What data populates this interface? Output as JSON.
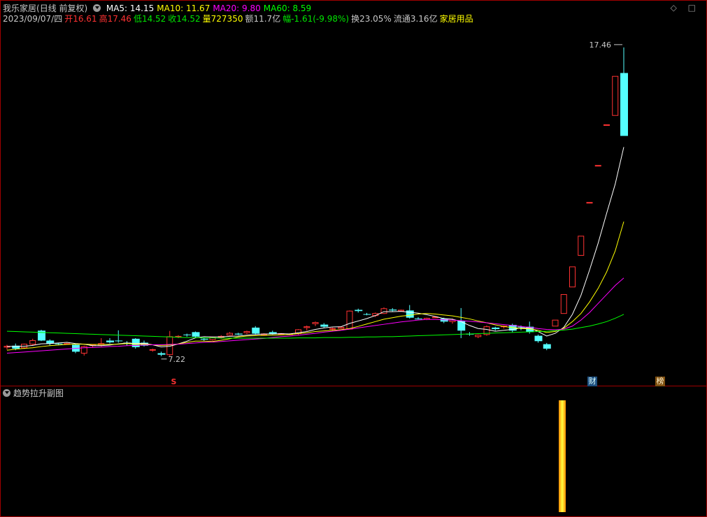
{
  "header": {
    "stock_name": "我乐家居",
    "mode": "(日线 前复权)",
    "ma_labels": [
      {
        "text": "MA5: 14.15",
        "color": "#ffffff"
      },
      {
        "text": "MA10: 11.67",
        "color": "#ffff00"
      },
      {
        "text": "MA20: 9.80",
        "color": "#ff00ff"
      },
      {
        "text": "MA60: 8.59",
        "color": "#00ff00"
      }
    ],
    "win_controls": "◇ □",
    "info": [
      {
        "text": "2023/09/07/四",
        "color": "#c8c8c8"
      },
      {
        "text": "开16.61",
        "color": "#ff3232"
      },
      {
        "text": "高17.46",
        "color": "#ff3232"
      },
      {
        "text": "低14.52",
        "color": "#00e600"
      },
      {
        "text": "收14.52",
        "color": "#00e600"
      },
      {
        "text": "量727350",
        "color": "#ffff00"
      },
      {
        "text": "额11.7亿",
        "color": "#c8c8c8"
      },
      {
        "text": "幅-1.61(-9.98%)",
        "color": "#00e600"
      },
      {
        "text": "换23.05%",
        "color": "#c8c8c8"
      },
      {
        "text": "流通3.16亿",
        "color": "#c8c8c8"
      },
      {
        "text": "家居用品",
        "color": "#ffff00"
      }
    ]
  },
  "chart_data": {
    "type": "candlestick",
    "price_range": [
      6.5,
      18.2
    ],
    "annotations": {
      "high_label": "17.46",
      "low_label": "7.22",
      "flag_s": "S",
      "flag_cai": "财",
      "flag_bang": "榜"
    },
    "candles": [
      [
        7.5,
        7.58,
        7.42,
        7.53
      ],
      [
        7.55,
        7.62,
        7.4,
        7.45
      ],
      [
        7.48,
        7.62,
        7.44,
        7.6
      ],
      [
        7.6,
        7.78,
        7.55,
        7.72
      ],
      [
        8.05,
        8.08,
        7.7,
        7.72
      ],
      [
        7.72,
        7.76,
        7.56,
        7.62
      ],
      [
        7.62,
        7.65,
        7.58,
        7.6
      ],
      [
        7.6,
        7.64,
        7.58,
        7.62
      ],
      [
        7.58,
        7.6,
        7.3,
        7.35
      ],
      [
        7.3,
        7.55,
        7.22,
        7.52
      ],
      [
        7.55,
        7.6,
        7.5,
        7.58
      ],
      [
        7.56,
        7.8,
        7.52,
        7.62
      ],
      [
        7.72,
        7.8,
        7.62,
        7.66
      ],
      [
        7.72,
        8.06,
        7.65,
        7.7
      ],
      [
        7.65,
        7.7,
        7.56,
        7.62
      ],
      [
        7.78,
        7.8,
        7.45,
        7.5
      ],
      [
        7.65,
        7.72,
        7.52,
        7.55
      ],
      [
        7.4,
        7.45,
        7.35,
        7.42
      ],
      [
        7.3,
        7.35,
        7.2,
        7.25
      ],
      [
        7.25,
        8.04,
        7.2,
        7.85
      ],
      [
        7.84,
        7.9,
        7.8,
        7.86
      ],
      [
        7.92,
        7.95,
        7.85,
        7.9
      ],
      [
        8.0,
        8.02,
        7.8,
        7.85
      ],
      [
        7.78,
        7.82,
        7.7,
        7.75
      ],
      [
        7.75,
        7.85,
        7.72,
        7.82
      ],
      [
        7.82,
        7.9,
        7.78,
        7.86
      ],
      [
        7.9,
        8.0,
        7.88,
        7.96
      ],
      [
        7.95,
        7.98,
        7.9,
        7.92
      ],
      [
        7.98,
        8.05,
        7.94,
        8.02
      ],
      [
        8.15,
        8.2,
        7.92,
        7.95
      ],
      [
        7.92,
        7.96,
        7.88,
        7.94
      ],
      [
        8.0,
        8.05,
        7.92,
        7.95
      ],
      [
        7.94,
        7.97,
        7.91,
        7.95
      ],
      [
        7.92,
        7.96,
        7.9,
        7.94
      ],
      [
        7.95,
        8.1,
        7.9,
        8.08
      ],
      [
        8.15,
        8.22,
        8.05,
        8.18
      ],
      [
        8.28,
        8.35,
        8.2,
        8.32
      ],
      [
        8.25,
        8.3,
        8.15,
        8.18
      ],
      [
        8.1,
        8.15,
        8.05,
        8.12
      ],
      [
        8.12,
        8.18,
        8.1,
        8.16
      ],
      [
        8.1,
        8.72,
        8.1,
        8.7
      ],
      [
        8.74,
        8.78,
        8.65,
        8.7
      ],
      [
        8.6,
        8.64,
        8.56,
        8.58
      ],
      [
        8.55,
        8.65,
        8.5,
        8.62
      ],
      [
        8.62,
        8.82,
        8.6,
        8.78
      ],
      [
        8.75,
        8.8,
        8.68,
        8.72
      ],
      [
        8.7,
        8.75,
        8.68,
        8.73
      ],
      [
        8.72,
        8.9,
        8.45,
        8.48
      ],
      [
        8.45,
        8.5,
        8.42,
        8.44
      ],
      [
        8.42,
        8.48,
        8.4,
        8.46
      ],
      [
        8.5,
        8.52,
        8.48,
        8.5
      ],
      [
        8.45,
        8.48,
        8.3,
        8.35
      ],
      [
        8.35,
        8.45,
        8.28,
        8.4
      ],
      [
        8.38,
        8.8,
        7.8,
        8.05
      ],
      [
        7.95,
        8.0,
        7.88,
        7.92
      ],
      [
        7.85,
        7.92,
        7.8,
        7.9
      ],
      [
        7.92,
        8.22,
        7.88,
        8.18
      ],
      [
        8.15,
        8.18,
        8.05,
        8.1
      ],
      [
        8.18,
        8.22,
        8.12,
        8.2
      ],
      [
        8.24,
        8.28,
        8.0,
        8.05
      ],
      [
        8.18,
        8.22,
        8.06,
        8.16
      ],
      [
        8.18,
        8.35,
        7.95,
        8.0
      ],
      [
        7.88,
        7.92,
        7.65,
        7.7
      ],
      [
        7.6,
        7.64,
        7.4,
        7.45
      ],
      [
        8.2,
        8.4,
        8.2,
        8.4
      ],
      [
        8.62,
        9.25,
        8.62,
        9.25
      ],
      [
        9.5,
        10.17,
        9.5,
        10.17
      ],
      [
        10.55,
        11.19,
        10.55,
        11.19
      ],
      [
        12.31,
        12.31,
        12.31,
        12.31
      ],
      [
        13.54,
        13.54,
        13.54,
        13.54
      ],
      [
        14.89,
        14.89,
        14.89,
        14.89
      ],
      [
        15.2,
        16.5,
        15.2,
        16.5
      ],
      [
        16.61,
        17.46,
        14.52,
        14.52
      ]
    ],
    "ma_series": [
      {
        "name": "MA5",
        "color": "#ffffff",
        "values": [
          7.52,
          7.53,
          7.53,
          7.56,
          7.61,
          7.62,
          7.64,
          7.66,
          7.62,
          7.6,
          7.55,
          7.55,
          7.57,
          7.61,
          7.64,
          7.62,
          7.63,
          7.58,
          7.51,
          7.53,
          7.61,
          7.7,
          7.81,
          7.85,
          7.84,
          7.84,
          7.86,
          7.87,
          7.9,
          7.92,
          7.94,
          7.94,
          7.95,
          7.94,
          7.98,
          8.02,
          8.09,
          8.14,
          8.17,
          8.18,
          8.29,
          8.37,
          8.45,
          8.55,
          8.68,
          8.68,
          8.69,
          8.66,
          8.63,
          8.58,
          8.52,
          8.45,
          8.43,
          8.35,
          8.22,
          8.12,
          8.09,
          8.03,
          8.06,
          8.09,
          8.14,
          8.14,
          8.02,
          7.87,
          7.96,
          8.16,
          8.59,
          9.22,
          10.06,
          10.95,
          11.95,
          12.92,
          14.15
        ]
      },
      {
        "name": "MA10",
        "color": "#ffff00",
        "values": [
          7.4,
          7.43,
          7.46,
          7.48,
          7.52,
          7.55,
          7.57,
          7.59,
          7.6,
          7.6,
          7.59,
          7.59,
          7.59,
          7.6,
          7.62,
          7.6,
          7.6,
          7.58,
          7.56,
          7.57,
          7.61,
          7.66,
          7.7,
          7.7,
          7.69,
          7.73,
          7.78,
          7.84,
          7.87,
          7.88,
          7.89,
          7.9,
          7.91,
          7.92,
          7.95,
          7.98,
          8.02,
          8.04,
          8.06,
          8.08,
          8.12,
          8.19,
          8.27,
          8.35,
          8.43,
          8.48,
          8.53,
          8.56,
          8.6,
          8.62,
          8.6,
          8.57,
          8.54,
          8.49,
          8.44,
          8.37,
          8.31,
          8.24,
          8.19,
          8.15,
          8.12,
          8.11,
          8.06,
          7.99,
          8.02,
          8.13,
          8.35,
          8.62,
          9.0,
          9.45,
          10.0,
          10.7,
          11.67
        ]
      },
      {
        "name": "MA20",
        "color": "#ff00ff",
        "values": [
          7.3,
          7.32,
          7.34,
          7.36,
          7.38,
          7.4,
          7.42,
          7.44,
          7.46,
          7.48,
          7.49,
          7.5,
          7.52,
          7.53,
          7.55,
          7.56,
          7.57,
          7.58,
          7.58,
          7.59,
          7.6,
          7.62,
          7.64,
          7.66,
          7.67,
          7.69,
          7.71,
          7.73,
          7.75,
          7.77,
          7.79,
          7.82,
          7.85,
          7.87,
          7.9,
          7.93,
          7.96,
          8.0,
          8.03,
          8.06,
          8.1,
          8.14,
          8.18,
          8.22,
          8.26,
          8.3,
          8.34,
          8.37,
          8.4,
          8.42,
          8.42,
          8.41,
          8.4,
          8.38,
          8.36,
          8.34,
          8.31,
          8.28,
          8.25,
          8.22,
          8.19,
          8.16,
          8.12,
          8.09,
          8.08,
          8.1,
          8.2,
          8.4,
          8.65,
          8.95,
          9.25,
          9.55,
          9.8
        ]
      },
      {
        "name": "MA60",
        "color": "#00ff00",
        "values": [
          8.03,
          8.02,
          8.01,
          8.0,
          7.99,
          7.98,
          7.97,
          7.96,
          7.95,
          7.94,
          7.93,
          7.92,
          7.91,
          7.9,
          7.89,
          7.88,
          7.87,
          7.86,
          7.85,
          7.84,
          7.83,
          7.82,
          7.82,
          7.81,
          7.81,
          7.8,
          7.8,
          7.8,
          7.8,
          7.8,
          7.8,
          7.8,
          7.8,
          7.8,
          7.81,
          7.81,
          7.81,
          7.82,
          7.82,
          7.82,
          7.83,
          7.83,
          7.84,
          7.84,
          7.85,
          7.85,
          7.86,
          7.87,
          7.88,
          7.89,
          7.9,
          7.91,
          7.92,
          7.93,
          7.94,
          7.95,
          7.96,
          7.97,
          7.98,
          7.99,
          8.0,
          8.01,
          8.02,
          8.03,
          8.05,
          8.07,
          8.1,
          8.15,
          8.2,
          8.27,
          8.35,
          8.46,
          8.59
        ]
      }
    ],
    "sub_chart": {
      "title": "趋势拉升副图",
      "bars": [
        {
          "index": 64,
          "value": 1
        }
      ]
    }
  }
}
